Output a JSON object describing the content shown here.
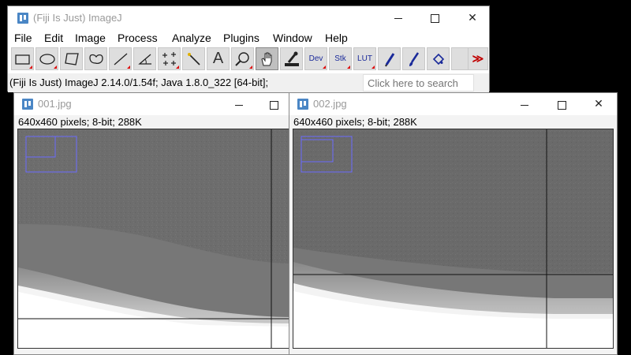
{
  "main_window": {
    "title": "(Fiji Is Just) ImageJ",
    "menus": [
      "File",
      "Edit",
      "Image",
      "Process",
      "Analyze",
      "Plugins",
      "Window",
      "Help"
    ],
    "toolbar_text": {
      "dev": "Dev",
      "stk": "Stk",
      "lut": "LUT",
      "text_tool": "A"
    },
    "status": "(Fiji Is Just) ImageJ 2.14.0/1.54f; Java 1.8.0_322 [64-bit];",
    "search_placeholder": "Click here to search",
    "close_glyph": "✕",
    "more_glyph": "≫"
  },
  "image_windows": [
    {
      "title": "001.jpg",
      "info": "640x460 pixels; 8-bit; 288K"
    },
    {
      "title": "002.jpg",
      "info": "640x460 pixels; 8-bit; 288K"
    }
  ],
  "colors": {
    "icon_blue": "#4a86c5",
    "overlay_blue": "#6b6bff",
    "gray_image": "#6e6e6e",
    "red_marker": "#d00000"
  }
}
